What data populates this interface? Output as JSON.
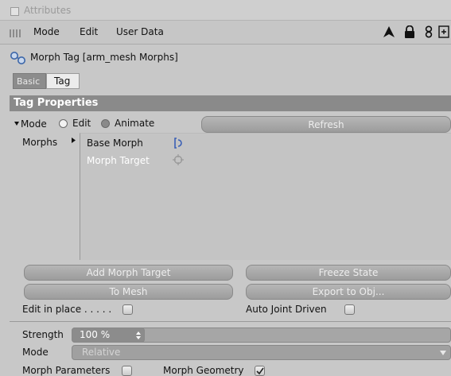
{
  "window": {
    "title": "Attributes"
  },
  "menu": {
    "mode": "Mode",
    "edit": "Edit",
    "user_data": "User Data"
  },
  "object": {
    "name": "Morph Tag [arm_mesh Morphs]"
  },
  "tabs": {
    "basic": "Basic",
    "tag": "Tag"
  },
  "section": {
    "title": "Tag Properties"
  },
  "mode_row": {
    "label": "Mode",
    "edit": "Edit",
    "animate": "Animate",
    "refresh": "Refresh",
    "selected": "Edit"
  },
  "morphs": {
    "label": "Morphs",
    "items": [
      {
        "label": "Base Morph",
        "icon": "bracket-icon"
      },
      {
        "label": "Morph Target",
        "icon": "target-icon"
      }
    ]
  },
  "buttons": {
    "add_morph_target": "Add Morph Target",
    "freeze_state": "Freeze State",
    "to_mesh": "To Mesh",
    "export_to_obj": "Export to Obj..."
  },
  "options": {
    "edit_in_place": "Edit in place . . . . .",
    "auto_joint_driven": "Auto Joint Driven"
  },
  "params": {
    "strength_label": "Strength",
    "strength_value": "100 %",
    "mode_label": "Mode",
    "mode_value": "Relative",
    "morph_parameters": "Morph Parameters",
    "morph_geometry": "Morph Geometry"
  },
  "colors": {
    "section_bg": "#8a8a8a",
    "panel_bg": "#c8c8c8",
    "button_bg": "#a8a8a8"
  }
}
